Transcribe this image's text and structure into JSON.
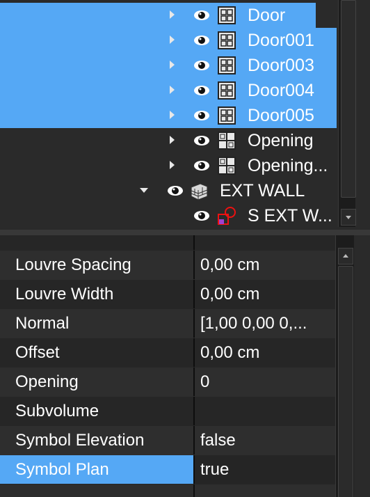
{
  "tree": {
    "items": [
      {
        "label": "Door",
        "icon": "door-icon",
        "selected": true
      },
      {
        "label": "Door001",
        "icon": "door-icon",
        "selected": true
      },
      {
        "label": "Door003",
        "icon": "door-icon",
        "selected": true
      },
      {
        "label": "Door004",
        "icon": "door-icon",
        "selected": true
      },
      {
        "label": "Door005",
        "icon": "door-icon",
        "selected": true
      },
      {
        "label": "Opening",
        "icon": "window-icon",
        "selected": false
      },
      {
        "label": "Opening...",
        "icon": "window-icon",
        "selected": false
      },
      {
        "label": "EXT WALL",
        "icon": "wall-icon",
        "selected": false,
        "expanded": true
      },
      {
        "label": "S EXT W...",
        "icon": "sketch-icon",
        "selected": false
      }
    ]
  },
  "properties": {
    "rows": [
      {
        "name": "Louvre Spacing",
        "value": "0,00 cm"
      },
      {
        "name": "Louvre Width",
        "value": "0,00 cm"
      },
      {
        "name": "Normal",
        "value": "[1,00 0,00 0,..."
      },
      {
        "name": "Offset",
        "value": "0,00 cm"
      },
      {
        "name": "Opening",
        "value": "0"
      },
      {
        "name": "Subvolume",
        "value": ""
      },
      {
        "name": "Symbol Elevation",
        "value": "false"
      },
      {
        "name": "Symbol Plan",
        "value": "true"
      }
    ]
  },
  "colors": {
    "selection": "#55a8f5",
    "panel": "#2a2a2a"
  }
}
